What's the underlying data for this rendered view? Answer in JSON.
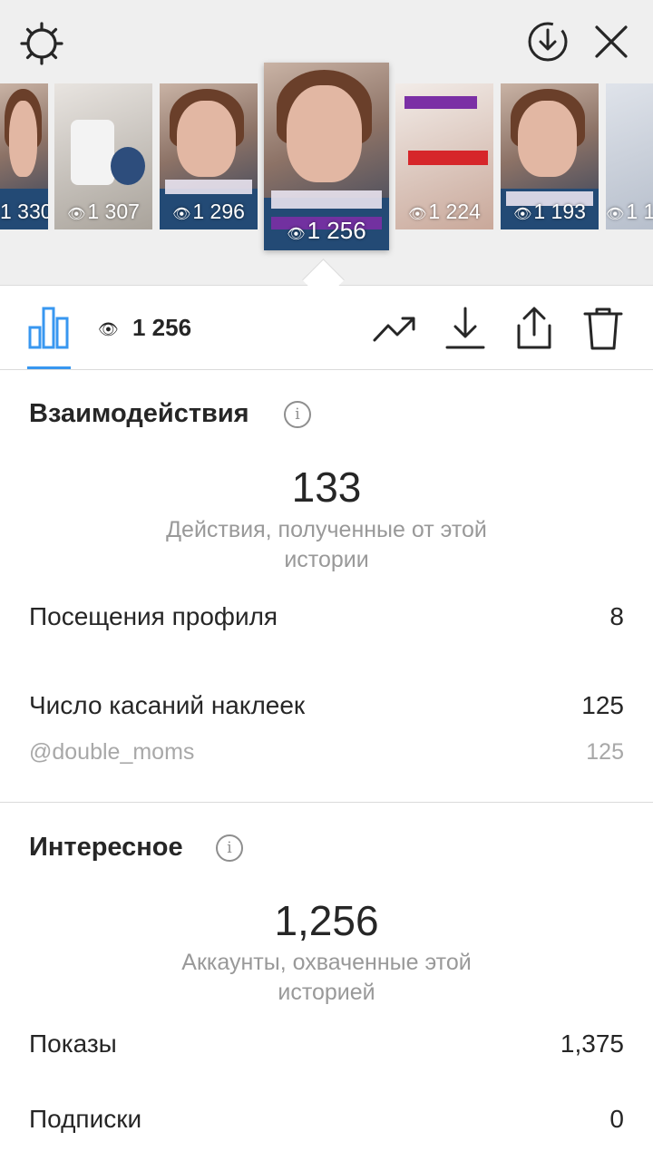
{
  "stories": [
    {
      "views": "1 330"
    },
    {
      "views": "1 307"
    },
    {
      "views": "1 296"
    },
    {
      "views": "1 256"
    },
    {
      "views": "1 224"
    },
    {
      "views": "1 193"
    },
    {
      "views": "1 1"
    }
  ],
  "toolbar": {
    "views_count": "1 256",
    "icons": [
      "bar-chart-icon",
      "trend-icon",
      "download-icon",
      "share-icon",
      "trash-icon"
    ]
  },
  "interactions": {
    "title": "Взаимодействия",
    "total": "133",
    "caption": "Действия, полученные от этой истории",
    "profile_visits_label": "Посещения профиля",
    "profile_visits_value": "8",
    "sticker_taps_label": "Число касаний наклеек",
    "sticker_taps_value": "125",
    "sticker_handle": "@double_moms",
    "sticker_handle_value": "125"
  },
  "discovery": {
    "title": "Интересное",
    "total": "1,256",
    "caption": "Аккаунты, охваченные этой историей",
    "impressions_label": "Показы",
    "impressions_value": "1,375",
    "follows_label": "Подписки",
    "follows_value": "0"
  },
  "colors": {
    "accent": "#3897f0",
    "text": "#262626",
    "secondary": "#999999"
  }
}
